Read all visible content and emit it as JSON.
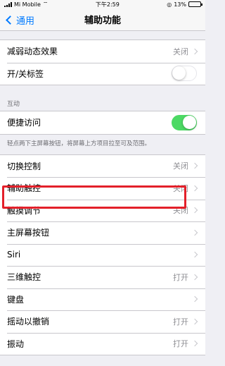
{
  "status_bar": {
    "carrier": "Mi Mobile",
    "time": "下午2:59",
    "battery": "13%",
    "battery_level": 0.13
  },
  "nav": {
    "back_label": "通用",
    "title": "辅助功能"
  },
  "group1": [
    {
      "label": "减弱动态效果",
      "value": "关闭"
    },
    {
      "label": "开/关标签",
      "toggle": false
    }
  ],
  "section_interaction": {
    "header": "互动",
    "rows": [
      {
        "label": "便捷访问",
        "toggle": true
      }
    ],
    "footer": "轻点两下主屏幕按钮，将屏幕上方项目拉至可及范围。"
  },
  "group3": [
    {
      "label": "切换控制",
      "value": "关闭"
    },
    {
      "label": "辅助触控",
      "value": "关闭"
    },
    {
      "label": "触摸调节",
      "value": "关闭"
    },
    {
      "label": "主屏幕按钮",
      "value": ""
    },
    {
      "label": "Siri",
      "value": ""
    },
    {
      "label": "三维触控",
      "value": "打开"
    },
    {
      "label": "键盘",
      "value": ""
    },
    {
      "label": "摇动以撤销",
      "value": "打开"
    },
    {
      "label": "振动",
      "value": "打开"
    }
  ],
  "colors": {
    "accent": "#007aff",
    "toggle_on": "#4cd964",
    "highlight": "#e3202a"
  }
}
